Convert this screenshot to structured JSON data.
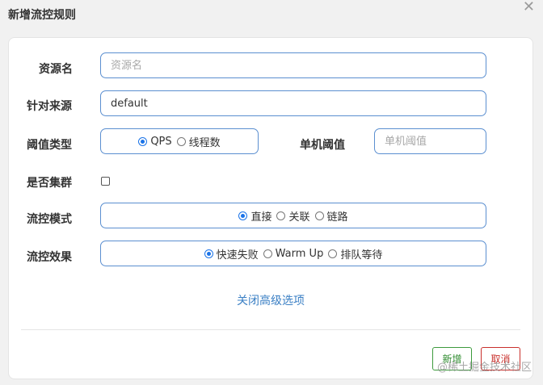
{
  "dialog": {
    "title": "新增流控规则",
    "close": "✕"
  },
  "form": {
    "resource": {
      "label": "资源名",
      "placeholder": "资源名",
      "value": ""
    },
    "limit_app": {
      "label": "针对来源",
      "value": "default"
    },
    "threshold_type": {
      "label": "阈值类型",
      "options": [
        {
          "label": "QPS",
          "selected": true
        },
        {
          "label": "线程数",
          "selected": false
        }
      ]
    },
    "single_threshold": {
      "label": "单机阈值",
      "placeholder": "单机阈值",
      "value": ""
    },
    "cluster": {
      "label": "是否集群",
      "checked": false
    },
    "flow_mode": {
      "label": "流控模式",
      "options": [
        {
          "label": "直接",
          "selected": true
        },
        {
          "label": "关联",
          "selected": false
        },
        {
          "label": "链路",
          "selected": false
        }
      ]
    },
    "flow_effect": {
      "label": "流控效果",
      "options": [
        {
          "label": "快速失败",
          "selected": true
        },
        {
          "label": "Warm Up",
          "selected": false
        },
        {
          "label": "排队等待",
          "selected": false
        }
      ]
    },
    "advanced_link": "关闭高级选项"
  },
  "footer": {
    "add_label": "新增",
    "cancel_label": "取消"
  },
  "watermark": "@稀土掘金技术社区",
  "colors": {
    "accent": "#1a73e8",
    "border": "#5b8fd0",
    "add": "#2e8b2e",
    "cancel": "#c9302c",
    "link": "#3a7fc4"
  }
}
